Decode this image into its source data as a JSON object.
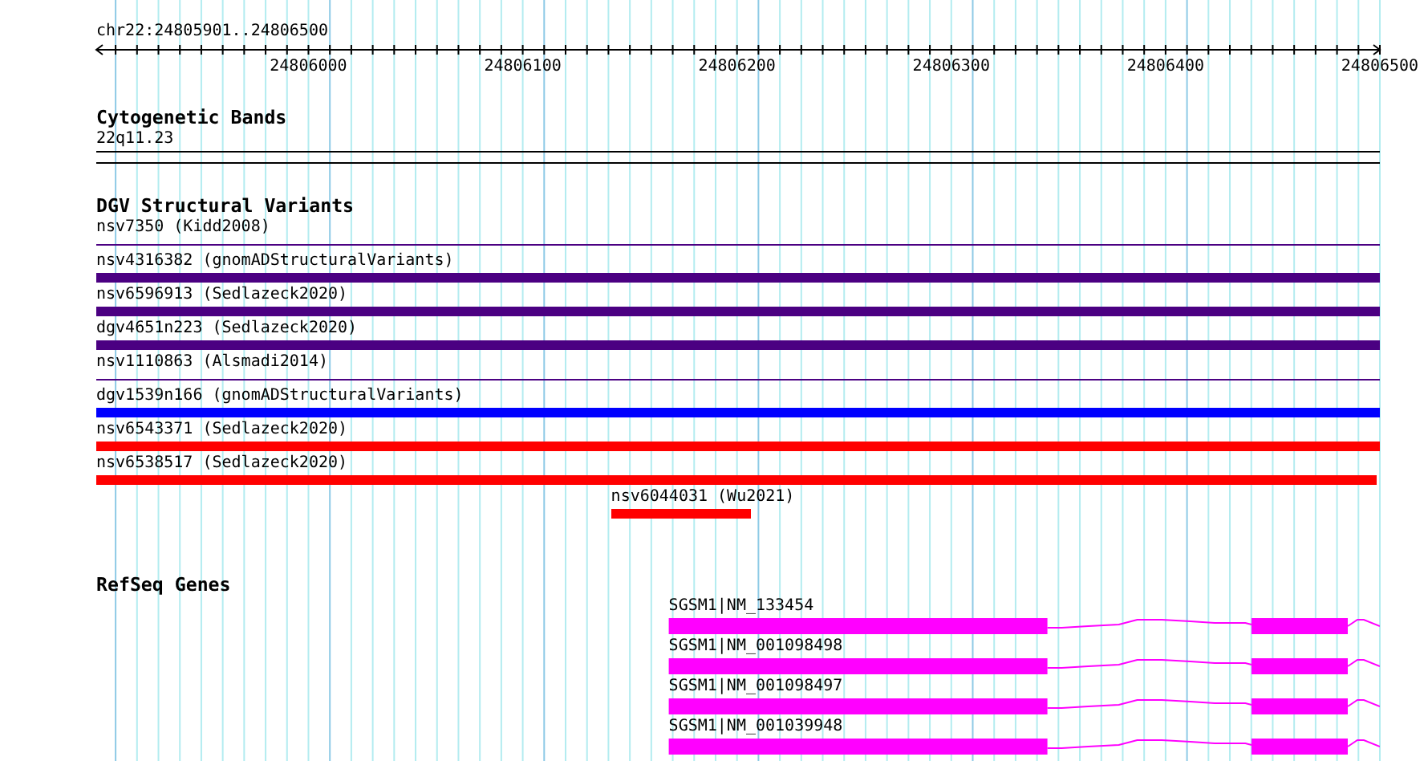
{
  "ruler": {
    "label": "chr22:24805901..24806500",
    "tick_labels": [
      "24806000",
      "24806100",
      "24806200",
      "24806300",
      "24806400",
      "24806500"
    ]
  },
  "tracks": [
    {
      "kind": "cytoband",
      "title": "Cytogenetic Bands",
      "band": {
        "name": "22q11.23"
      }
    },
    {
      "kind": "variants",
      "title": "DGV Structural Variants",
      "items": [
        {
          "label": "nsv7350 (Kidd2008)",
          "kind": "thin",
          "color": "#4b0082"
        },
        {
          "label": "nsv4316382 (gnomADStructuralVariants)",
          "kind": "thick",
          "color": "#4b0082"
        },
        {
          "label": "nsv6596913 (Sedlazeck2020)",
          "kind": "thick",
          "color": "#4b0082"
        },
        {
          "label": "dgv4651n223 (Sedlazeck2020)",
          "kind": "thick",
          "color": "#4b0082"
        },
        {
          "label": "nsv1110863 (Alsmadi2014)",
          "kind": "thin",
          "color": "#4b0082"
        },
        {
          "label": "dgv1539n166 (gnomADStructuralVariants)",
          "kind": "thick",
          "color": "#0000ff"
        },
        {
          "label": "nsv6543371 (Sedlazeck2020)",
          "kind": "thick",
          "color": "#ff0000"
        },
        {
          "label": "nsv6538517 (Sedlazeck2020)",
          "kind": "thick",
          "color": "#ff0000"
        },
        {
          "label": "nsv6044031 (Wu2021)",
          "kind": "thick",
          "color": "#ff0000"
        }
      ]
    },
    {
      "kind": "genes",
      "title": "RefSeq Genes",
      "items": [
        {
          "label": "SGSM1|NM_133454",
          "continues_right": true
        },
        {
          "label": "SGSM1|NM_001098498",
          "continues_right": true
        },
        {
          "label": "SGSM1|NM_001098497",
          "continues_right": true
        },
        {
          "label": "SGSM1|NM_001039948",
          "continues_right": true
        }
      ]
    }
  ]
}
